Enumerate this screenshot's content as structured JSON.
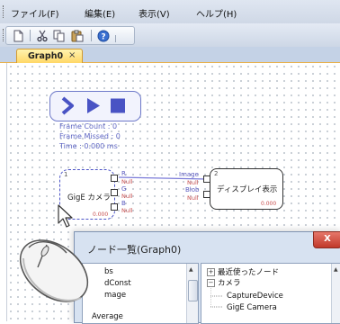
{
  "menubar": {
    "items": [
      "ファイル(F)",
      "編集(E)",
      "表示(V)",
      "ヘルプ(H)"
    ]
  },
  "toolbar": {
    "icons": [
      "new-document-icon",
      "cut-icon",
      "copy-icon",
      "paste-icon",
      "help-icon"
    ]
  },
  "tab": {
    "label": "Graph0",
    "close": "×"
  },
  "canvas": {
    "play_block": {
      "frame_count": "Frame Count : 0",
      "frame_missed": "Frame Missed : 0",
      "time": "Time :  0.000 ms"
    },
    "gige_node": {
      "number": "1",
      "label": "GigE カメラ",
      "time": "0.000",
      "ports": [
        {
          "name": "R",
          "value": "Null"
        },
        {
          "name": "G",
          "value": "Null"
        },
        {
          "name": "B",
          "value": "Null"
        }
      ]
    },
    "display_node": {
      "number": "2",
      "label": "ディスプレイ表示",
      "time": "0.000",
      "ports": [
        {
          "name": "Image",
          "value": "Null"
        },
        {
          "name": "Blob",
          "value": "Null"
        }
      ]
    }
  },
  "dialog": {
    "title": "ノード一覧(Graph0)",
    "close": "X",
    "left_list": [
      "bs",
      "dConst",
      "mage",
      "Average"
    ],
    "tree": {
      "recent": "最近使ったノード",
      "camera": "カメラ",
      "children": [
        "CaptureDevice",
        "GigE Camera"
      ]
    }
  },
  "colors": {
    "accent": "#5f67c4",
    "null_text": "#c75050",
    "tab_active": "#ffd767"
  }
}
